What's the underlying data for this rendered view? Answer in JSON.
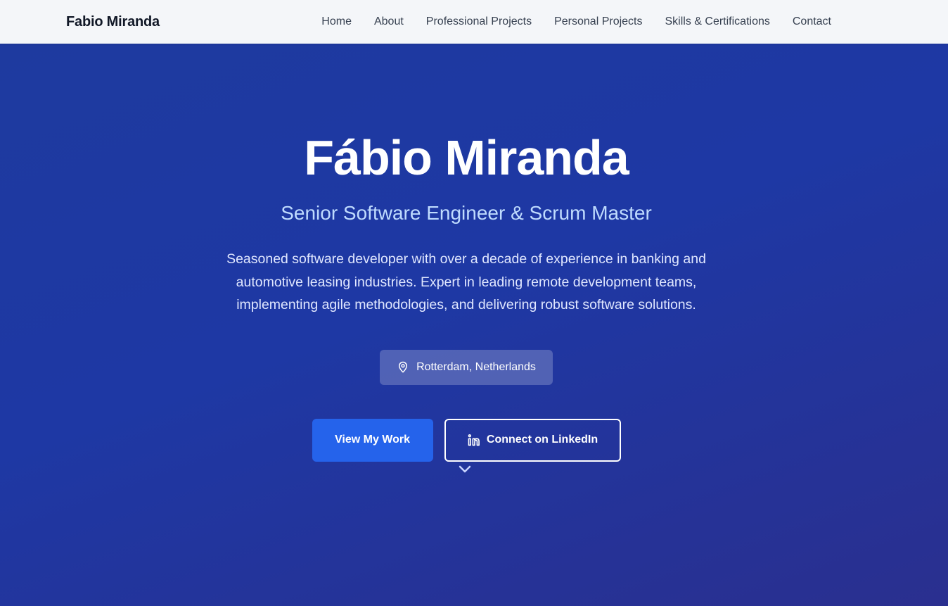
{
  "nav": {
    "brand": "Fabio Miranda",
    "links": [
      "Home",
      "About",
      "Professional Projects",
      "Personal Projects",
      "Skills & Certifications",
      "Contact"
    ]
  },
  "hero": {
    "title": "Fábio Miranda",
    "subtitle": "Senior Software Engineer & Scrum Master",
    "description": "Seasoned software developer with over a decade of experience in banking and automotive leasing industries. Expert in leading remote development teams, implementing agile methodologies, and delivering robust software solutions.",
    "location": "Rotterdam, Netherlands",
    "primary_button": "View My Work",
    "secondary_button": "Connect on LinkedIn"
  },
  "icons": {
    "location": "map-pin-icon",
    "linkedin": "linkedin-icon",
    "scroll": "chevron-down-icon"
  },
  "colors": {
    "accent": "#2563eb",
    "hero_bg": "#1e3a9f",
    "subtitle": "#bfdbfe"
  }
}
